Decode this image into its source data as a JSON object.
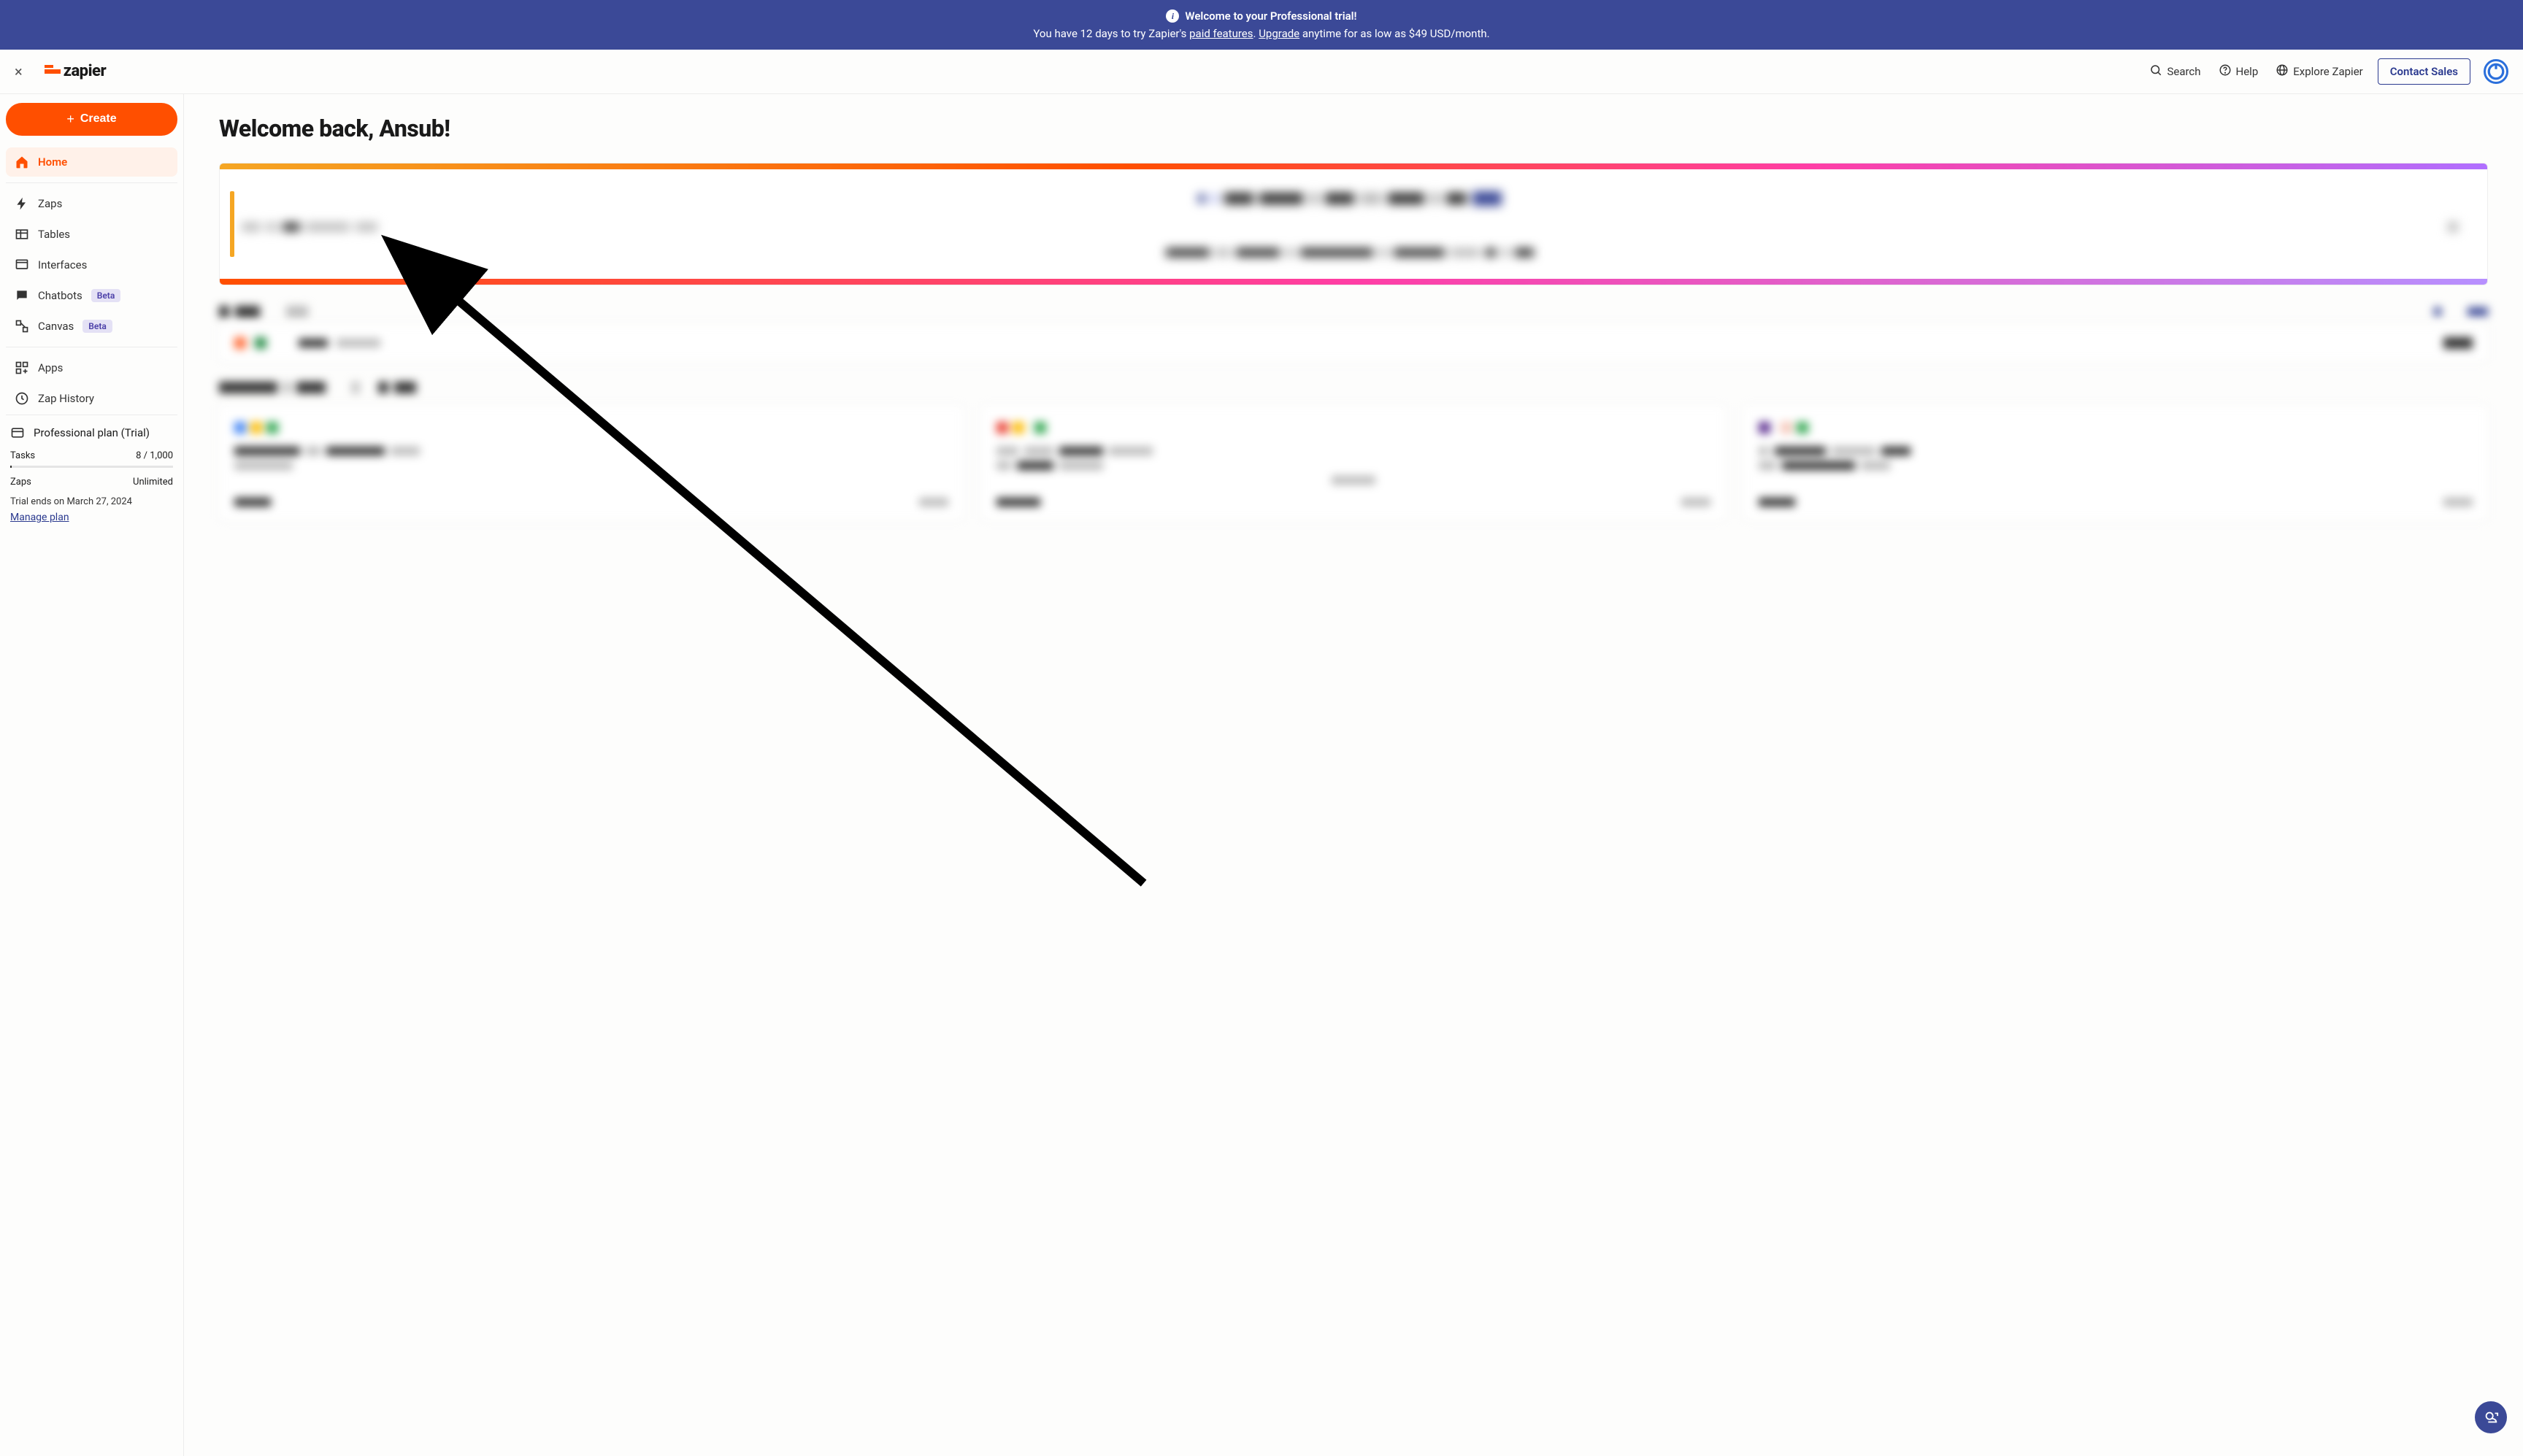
{
  "banner": {
    "title": "Welcome to your Professional trial!",
    "line_prefix": "You have 12 days to try Zapier's ",
    "paid_features": "paid features",
    "period": ". ",
    "upgrade": "Upgrade",
    "line_suffix": " anytime for as low as $49 USD/month."
  },
  "header": {
    "logo_text": "zapier",
    "search": "Search",
    "help": "Help",
    "explore": "Explore Zapier",
    "contact_sales": "Contact Sales"
  },
  "sidebar": {
    "create": "Create",
    "nav": {
      "home": "Home",
      "zaps": "Zaps",
      "tables": "Tables",
      "interfaces": "Interfaces",
      "chatbots": "Chatbots",
      "canvas": "Canvas",
      "apps": "Apps",
      "zap_history": "Zap History"
    },
    "badge_beta": "Beta",
    "plan": {
      "title": "Professional plan (Trial)",
      "tasks_label": "Tasks",
      "tasks_value": "8 / 1,000",
      "zaps_label": "Zaps",
      "zaps_value": "Unlimited",
      "trial_ends": "Trial ends on March 27, 2024",
      "manage": "Manage plan"
    }
  },
  "main": {
    "welcome": "Welcome back, Ansub!"
  }
}
